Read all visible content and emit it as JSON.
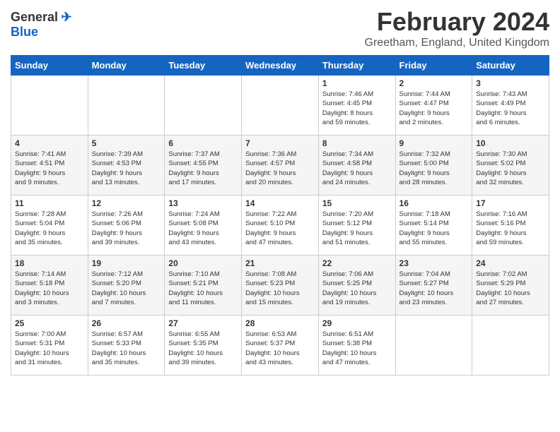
{
  "header": {
    "logo_general": "General",
    "logo_blue": "Blue",
    "month_title": "February 2024",
    "location": "Greetham, England, United Kingdom"
  },
  "days_of_week": [
    "Sunday",
    "Monday",
    "Tuesday",
    "Wednesday",
    "Thursday",
    "Friday",
    "Saturday"
  ],
  "weeks": [
    {
      "days": [
        {
          "num": "",
          "info": ""
        },
        {
          "num": "",
          "info": ""
        },
        {
          "num": "",
          "info": ""
        },
        {
          "num": "",
          "info": ""
        },
        {
          "num": "1",
          "info": "Sunrise: 7:46 AM\nSunset: 4:45 PM\nDaylight: 8 hours\nand 59 minutes."
        },
        {
          "num": "2",
          "info": "Sunrise: 7:44 AM\nSunset: 4:47 PM\nDaylight: 9 hours\nand 2 minutes."
        },
        {
          "num": "3",
          "info": "Sunrise: 7:43 AM\nSunset: 4:49 PM\nDaylight: 9 hours\nand 6 minutes."
        }
      ]
    },
    {
      "days": [
        {
          "num": "4",
          "info": "Sunrise: 7:41 AM\nSunset: 4:51 PM\nDaylight: 9 hours\nand 9 minutes."
        },
        {
          "num": "5",
          "info": "Sunrise: 7:39 AM\nSunset: 4:53 PM\nDaylight: 9 hours\nand 13 minutes."
        },
        {
          "num": "6",
          "info": "Sunrise: 7:37 AM\nSunset: 4:55 PM\nDaylight: 9 hours\nand 17 minutes."
        },
        {
          "num": "7",
          "info": "Sunrise: 7:36 AM\nSunset: 4:57 PM\nDaylight: 9 hours\nand 20 minutes."
        },
        {
          "num": "8",
          "info": "Sunrise: 7:34 AM\nSunset: 4:58 PM\nDaylight: 9 hours\nand 24 minutes."
        },
        {
          "num": "9",
          "info": "Sunrise: 7:32 AM\nSunset: 5:00 PM\nDaylight: 9 hours\nand 28 minutes."
        },
        {
          "num": "10",
          "info": "Sunrise: 7:30 AM\nSunset: 5:02 PM\nDaylight: 9 hours\nand 32 minutes."
        }
      ]
    },
    {
      "days": [
        {
          "num": "11",
          "info": "Sunrise: 7:28 AM\nSunset: 5:04 PM\nDaylight: 9 hours\nand 35 minutes."
        },
        {
          "num": "12",
          "info": "Sunrise: 7:26 AM\nSunset: 5:06 PM\nDaylight: 9 hours\nand 39 minutes."
        },
        {
          "num": "13",
          "info": "Sunrise: 7:24 AM\nSunset: 5:08 PM\nDaylight: 9 hours\nand 43 minutes."
        },
        {
          "num": "14",
          "info": "Sunrise: 7:22 AM\nSunset: 5:10 PM\nDaylight: 9 hours\nand 47 minutes."
        },
        {
          "num": "15",
          "info": "Sunrise: 7:20 AM\nSunset: 5:12 PM\nDaylight: 9 hours\nand 51 minutes."
        },
        {
          "num": "16",
          "info": "Sunrise: 7:18 AM\nSunset: 5:14 PM\nDaylight: 9 hours\nand 55 minutes."
        },
        {
          "num": "17",
          "info": "Sunrise: 7:16 AM\nSunset: 5:16 PM\nDaylight: 9 hours\nand 59 minutes."
        }
      ]
    },
    {
      "days": [
        {
          "num": "18",
          "info": "Sunrise: 7:14 AM\nSunset: 5:18 PM\nDaylight: 10 hours\nand 3 minutes."
        },
        {
          "num": "19",
          "info": "Sunrise: 7:12 AM\nSunset: 5:20 PM\nDaylight: 10 hours\nand 7 minutes."
        },
        {
          "num": "20",
          "info": "Sunrise: 7:10 AM\nSunset: 5:21 PM\nDaylight: 10 hours\nand 11 minutes."
        },
        {
          "num": "21",
          "info": "Sunrise: 7:08 AM\nSunset: 5:23 PM\nDaylight: 10 hours\nand 15 minutes."
        },
        {
          "num": "22",
          "info": "Sunrise: 7:06 AM\nSunset: 5:25 PM\nDaylight: 10 hours\nand 19 minutes."
        },
        {
          "num": "23",
          "info": "Sunrise: 7:04 AM\nSunset: 5:27 PM\nDaylight: 10 hours\nand 23 minutes."
        },
        {
          "num": "24",
          "info": "Sunrise: 7:02 AM\nSunset: 5:29 PM\nDaylight: 10 hours\nand 27 minutes."
        }
      ]
    },
    {
      "days": [
        {
          "num": "25",
          "info": "Sunrise: 7:00 AM\nSunset: 5:31 PM\nDaylight: 10 hours\nand 31 minutes."
        },
        {
          "num": "26",
          "info": "Sunrise: 6:57 AM\nSunset: 5:33 PM\nDaylight: 10 hours\nand 35 minutes."
        },
        {
          "num": "27",
          "info": "Sunrise: 6:55 AM\nSunset: 5:35 PM\nDaylight: 10 hours\nand 39 minutes."
        },
        {
          "num": "28",
          "info": "Sunrise: 6:53 AM\nSunset: 5:37 PM\nDaylight: 10 hours\nand 43 minutes."
        },
        {
          "num": "29",
          "info": "Sunrise: 6:51 AM\nSunset: 5:38 PM\nDaylight: 10 hours\nand 47 minutes."
        },
        {
          "num": "",
          "info": ""
        },
        {
          "num": "",
          "info": ""
        }
      ]
    }
  ]
}
